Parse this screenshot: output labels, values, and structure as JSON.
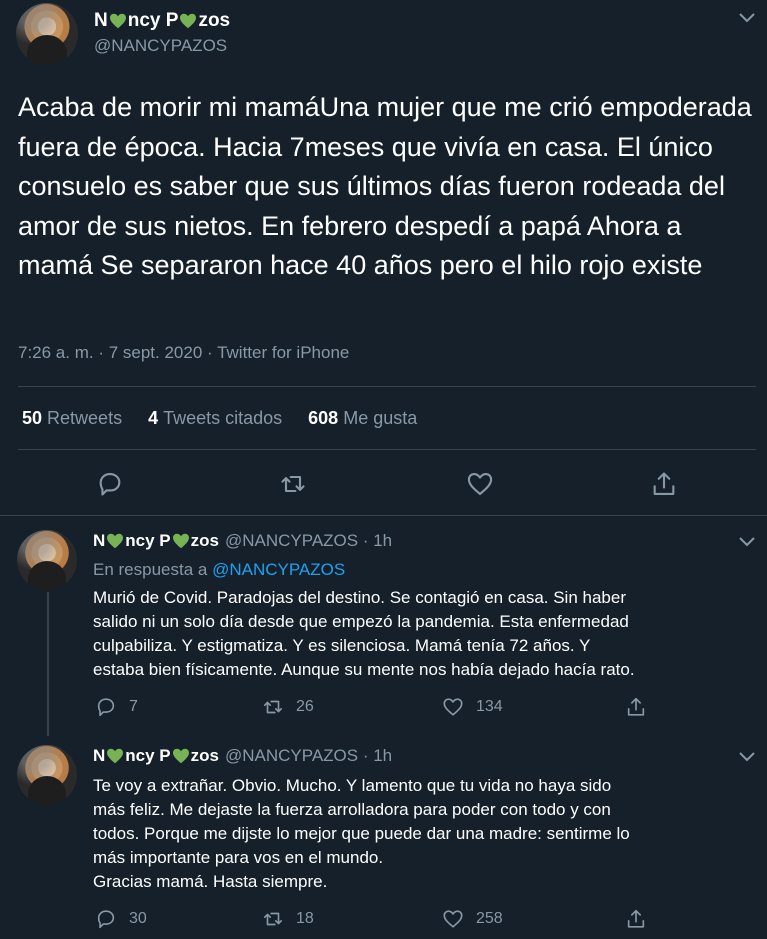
{
  "main": {
    "name_parts": [
      "N",
      "ncy P",
      "zos"
    ],
    "handle": "@NANCYPAZOS",
    "text": "Acaba de morir mi mamáUna mujer que me crió empoderada fuera de época. Hacia 7meses que vivía en casa.  El único consuelo es saber que sus últimos días fueron rodeada del amor de sus nietos. En febrero despedí a papá Ahora a mamá Se separaron hace 40 años pero el hilo rojo existe",
    "timestamp": "7:26 a. m. · 7 sept. 2020 · Twitter for iPhone",
    "stats": {
      "retweets_count": "50",
      "retweets_label": "Retweets",
      "quotes_count": "4",
      "quotes_label": "Tweets citados",
      "likes_count": "608",
      "likes_label": "Me gusta"
    }
  },
  "replies": [
    {
      "handle": "@NANCYPAZOS · 1h",
      "in_reply_prefix": "En respuesta a",
      "in_reply_handle": "@NANCYPAZOS",
      "lines": [
        "Murió de Covid. Paradojas del destino. Se contagió en casa. Sin haber",
        "salido ni un solo día desde que empezó la pandemia. Esta enfermedad",
        "culpabiliza. Y estigmatiza. Y es silenciosa. Mamá tenía 72 años. Y",
        "estaba bien físicamente. Aunque su mente nos había dejado hacía rato."
      ],
      "replies": "7",
      "retweets": "26",
      "likes": "134"
    },
    {
      "handle": "@NANCYPAZOS · 1h",
      "lines": [
        "Te voy a extrañar. Obvio. Mucho. Y lamento que tu vida no haya sido",
        "más feliz. Me dejaste la fuerza arrolladora para poder con todo y con",
        "todos. Porque me dijste lo mejor que puede dar una madre: sentirme lo",
        "más importante para vos en el mundo.",
        "Gracias mamá. Hasta siempre."
      ],
      "replies": "30",
      "retweets": "18",
      "likes": "258"
    }
  ],
  "colors": {
    "background": "#15202b",
    "secondary_text": "#8899a6",
    "link": "#1da1f2",
    "heart_green": "#77b255",
    "divider": "#38444d"
  }
}
